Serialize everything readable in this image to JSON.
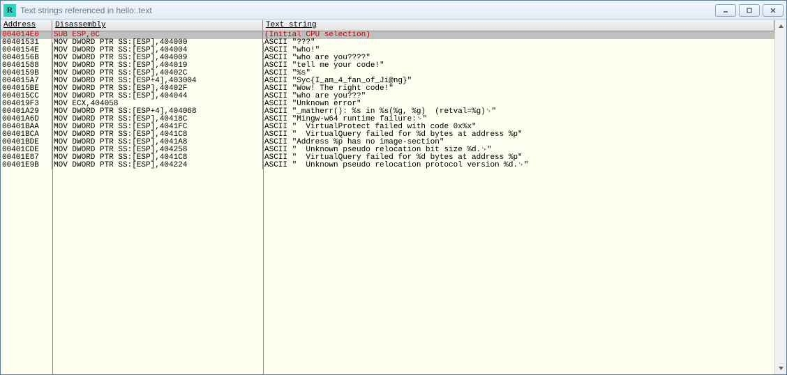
{
  "window": {
    "title": "Text strings referenced in hello:.text",
    "app_icon_letter": "R"
  },
  "columns": {
    "address": "Address",
    "disassembly": "Disassembly",
    "text_string": "Text string"
  },
  "rows": [
    {
      "address": "004014E0",
      "disassembly": "SUB ESP,0C",
      "text": "(Initial CPU selection)",
      "selected": true
    },
    {
      "address": "00401531",
      "disassembly": "MOV DWORD PTR SS:[ESP],404000",
      "text": "ASCII \"???\""
    },
    {
      "address": "0040154E",
      "disassembly": "MOV DWORD PTR SS:[ESP],404004",
      "text": "ASCII \"who!\""
    },
    {
      "address": "0040156B",
      "disassembly": "MOV DWORD PTR SS:[ESP],404009",
      "text": "ASCII \"who are you????\""
    },
    {
      "address": "00401588",
      "disassembly": "MOV DWORD PTR SS:[ESP],404019",
      "text": "ASCII \"tell me your code!\""
    },
    {
      "address": "0040159B",
      "disassembly": "MOV DWORD PTR SS:[ESP],40402C",
      "text": "ASCII \"%s\""
    },
    {
      "address": "004015A7",
      "disassembly": "MOV DWORD PTR SS:[ESP+4],403004",
      "text": "ASCII \"Syc{I_am_4_fan_of_Ji@ng}\""
    },
    {
      "address": "004015BE",
      "disassembly": "MOV DWORD PTR SS:[ESP],40402F",
      "text": "ASCII \"Wow! The right code!\""
    },
    {
      "address": "004015CC",
      "disassembly": "MOV DWORD PTR SS:[ESP],404044",
      "text": "ASCII \"who are you???\""
    },
    {
      "address": "004019F3",
      "disassembly": "MOV ECX,404058",
      "text": "ASCII \"Unknown error\""
    },
    {
      "address": "00401A29",
      "disassembly": "MOV DWORD PTR SS:[ESP+4],404068",
      "text": "ASCII \"_matherr(): %s in %s(%g, %g)  (retval=%g)␊\""
    },
    {
      "address": "00401A6D",
      "disassembly": "MOV DWORD PTR SS:[ESP],40418C",
      "text": "ASCII \"Mingw-w64 runtime failure:␊\""
    },
    {
      "address": "00401BAA",
      "disassembly": "MOV DWORD PTR SS:[ESP],4041FC",
      "text": "ASCII \"  VirtualProtect failed with code 0x%x\""
    },
    {
      "address": "00401BCA",
      "disassembly": "MOV DWORD PTR SS:[ESP],4041C8",
      "text": "ASCII \"  VirtualQuery failed for %d bytes at address %p\""
    },
    {
      "address": "00401BDE",
      "disassembly": "MOV DWORD PTR SS:[ESP],4041A8",
      "text": "ASCII \"Address %p has no image-section\""
    },
    {
      "address": "00401CDE",
      "disassembly": "MOV DWORD PTR SS:[ESP],404258",
      "text": "ASCII \"  Unknown pseudo relocation bit size %d.␊\""
    },
    {
      "address": "00401E87",
      "disassembly": "MOV DWORD PTR SS:[ESP],4041C8",
      "text": "ASCII \"  VirtualQuery failed for %d bytes at address %p\""
    },
    {
      "address": "00401E9B",
      "disassembly": "MOV DWORD PTR SS:[ESP],404224",
      "text": "ASCII \"  Unknown pseudo relocation protocol version %d.␊\""
    }
  ]
}
